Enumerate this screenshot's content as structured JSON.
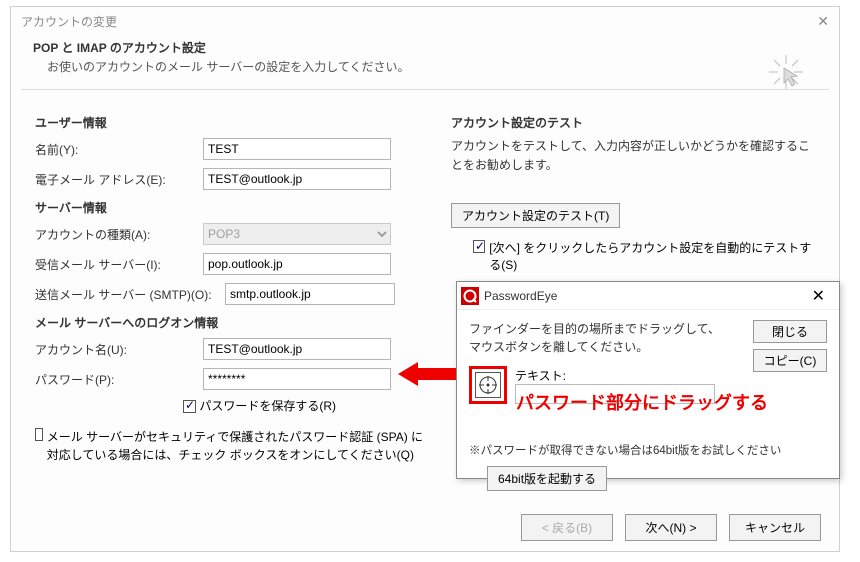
{
  "dialog": {
    "title": "アカウントの変更",
    "header_title": "POP と IMAP のアカウント設定",
    "header_sub": "お使いのアカウントのメール サーバーの設定を入力してください。"
  },
  "user_info": {
    "title": "ユーザー情報",
    "name_label": "名前(Y):",
    "name_value": "TEST",
    "email_label": "電子メール アドレス(E):",
    "email_value": "TEST@outlook.jp"
  },
  "server_info": {
    "title": "サーバー情報",
    "type_label": "アカウントの種類(A):",
    "type_value": "POP3",
    "incoming_label": "受信メール サーバー(I):",
    "incoming_value": "pop.outlook.jp",
    "outgoing_label": "送信メール サーバー (SMTP)(O):",
    "outgoing_value": "smtp.outlook.jp"
  },
  "logon_info": {
    "title": "メール サーバーへのログオン情報",
    "account_label": "アカウント名(U):",
    "account_value": "TEST@outlook.jp",
    "password_label": "パスワード(P):",
    "password_value": "********",
    "save_pw_label": "パスワードを保存する(R)",
    "spa_label": "メール サーバーがセキュリティで保護されたパスワード認証 (SPA) に対応している場合には、チェック ボックスをオンにしてください(Q)"
  },
  "test": {
    "title": "アカウント設定のテスト",
    "text": "アカウントをテストして、入力内容が正しいかどうかを確認することをお勧めします。",
    "button": "アカウント設定のテスト(T)",
    "auto_label": "[次へ] をクリックしたらアカウント設定を自動的にテストする(S)"
  },
  "footer": {
    "back": "< 戻る(B)",
    "next": "次へ(N) >",
    "cancel": "キャンセル"
  },
  "password_eye": {
    "title": "PasswordEye",
    "instruction": "ファインダーを目的の場所までドラッグして、マウスボタンを離してください。",
    "close_btn": "閉じる",
    "copy_btn": "コピー(C)",
    "text_label": "テキスト:",
    "note": "※パスワードが取得できない場合は64bit版をお試しください",
    "btn64": "64bit版を起動する"
  },
  "annotation": {
    "drag_text": "パスワード部分にドラッグする"
  }
}
